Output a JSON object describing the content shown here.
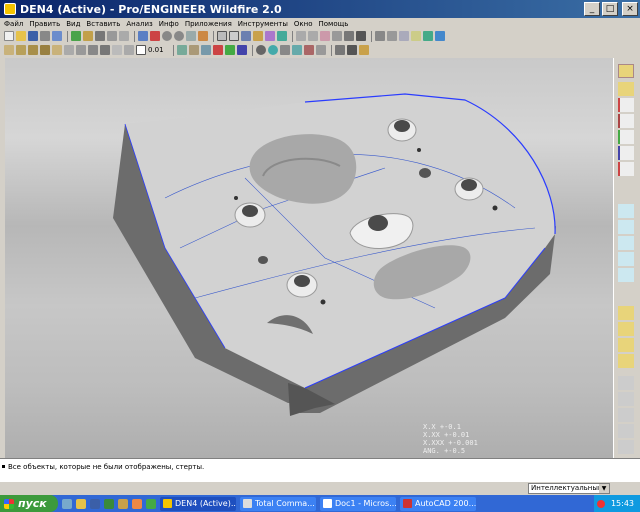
{
  "window": {
    "title": "DEN4 (Active) - Pro/ENGINEER Wildfire 2.0"
  },
  "menu": [
    "Файл",
    "Править",
    "Вид",
    "Вставить",
    "Анализ",
    "Инфо",
    "Приложения",
    "Инструменты",
    "Окно",
    "Помощь"
  ],
  "toolbar": {
    "tolerance_value": "0.01"
  },
  "viewport": {
    "tolerance_lines": [
      "X.X   +-0.1",
      "X.XX  +-0.01",
      "X.XXX +-0.001",
      "ANG.  +-0.5"
    ]
  },
  "message_area": {
    "message": "Все объекты, которые не были отображены, стерты."
  },
  "status": {
    "filter_value": "Интеллектуальный"
  },
  "taskbar": {
    "start_label": "пуск",
    "tasks": [
      "DEN4 (Active)...",
      "Total Comma...",
      "Doc1 - Micros...",
      "AutoCAD 200..."
    ],
    "clock": "15:43"
  },
  "colors": {
    "title_start": "#0a246a",
    "title_end": "#3a6ea5",
    "edge_highlight": "#2a3cff",
    "part_top": "#d2d2d2",
    "part_side": "#6c6c6c"
  }
}
